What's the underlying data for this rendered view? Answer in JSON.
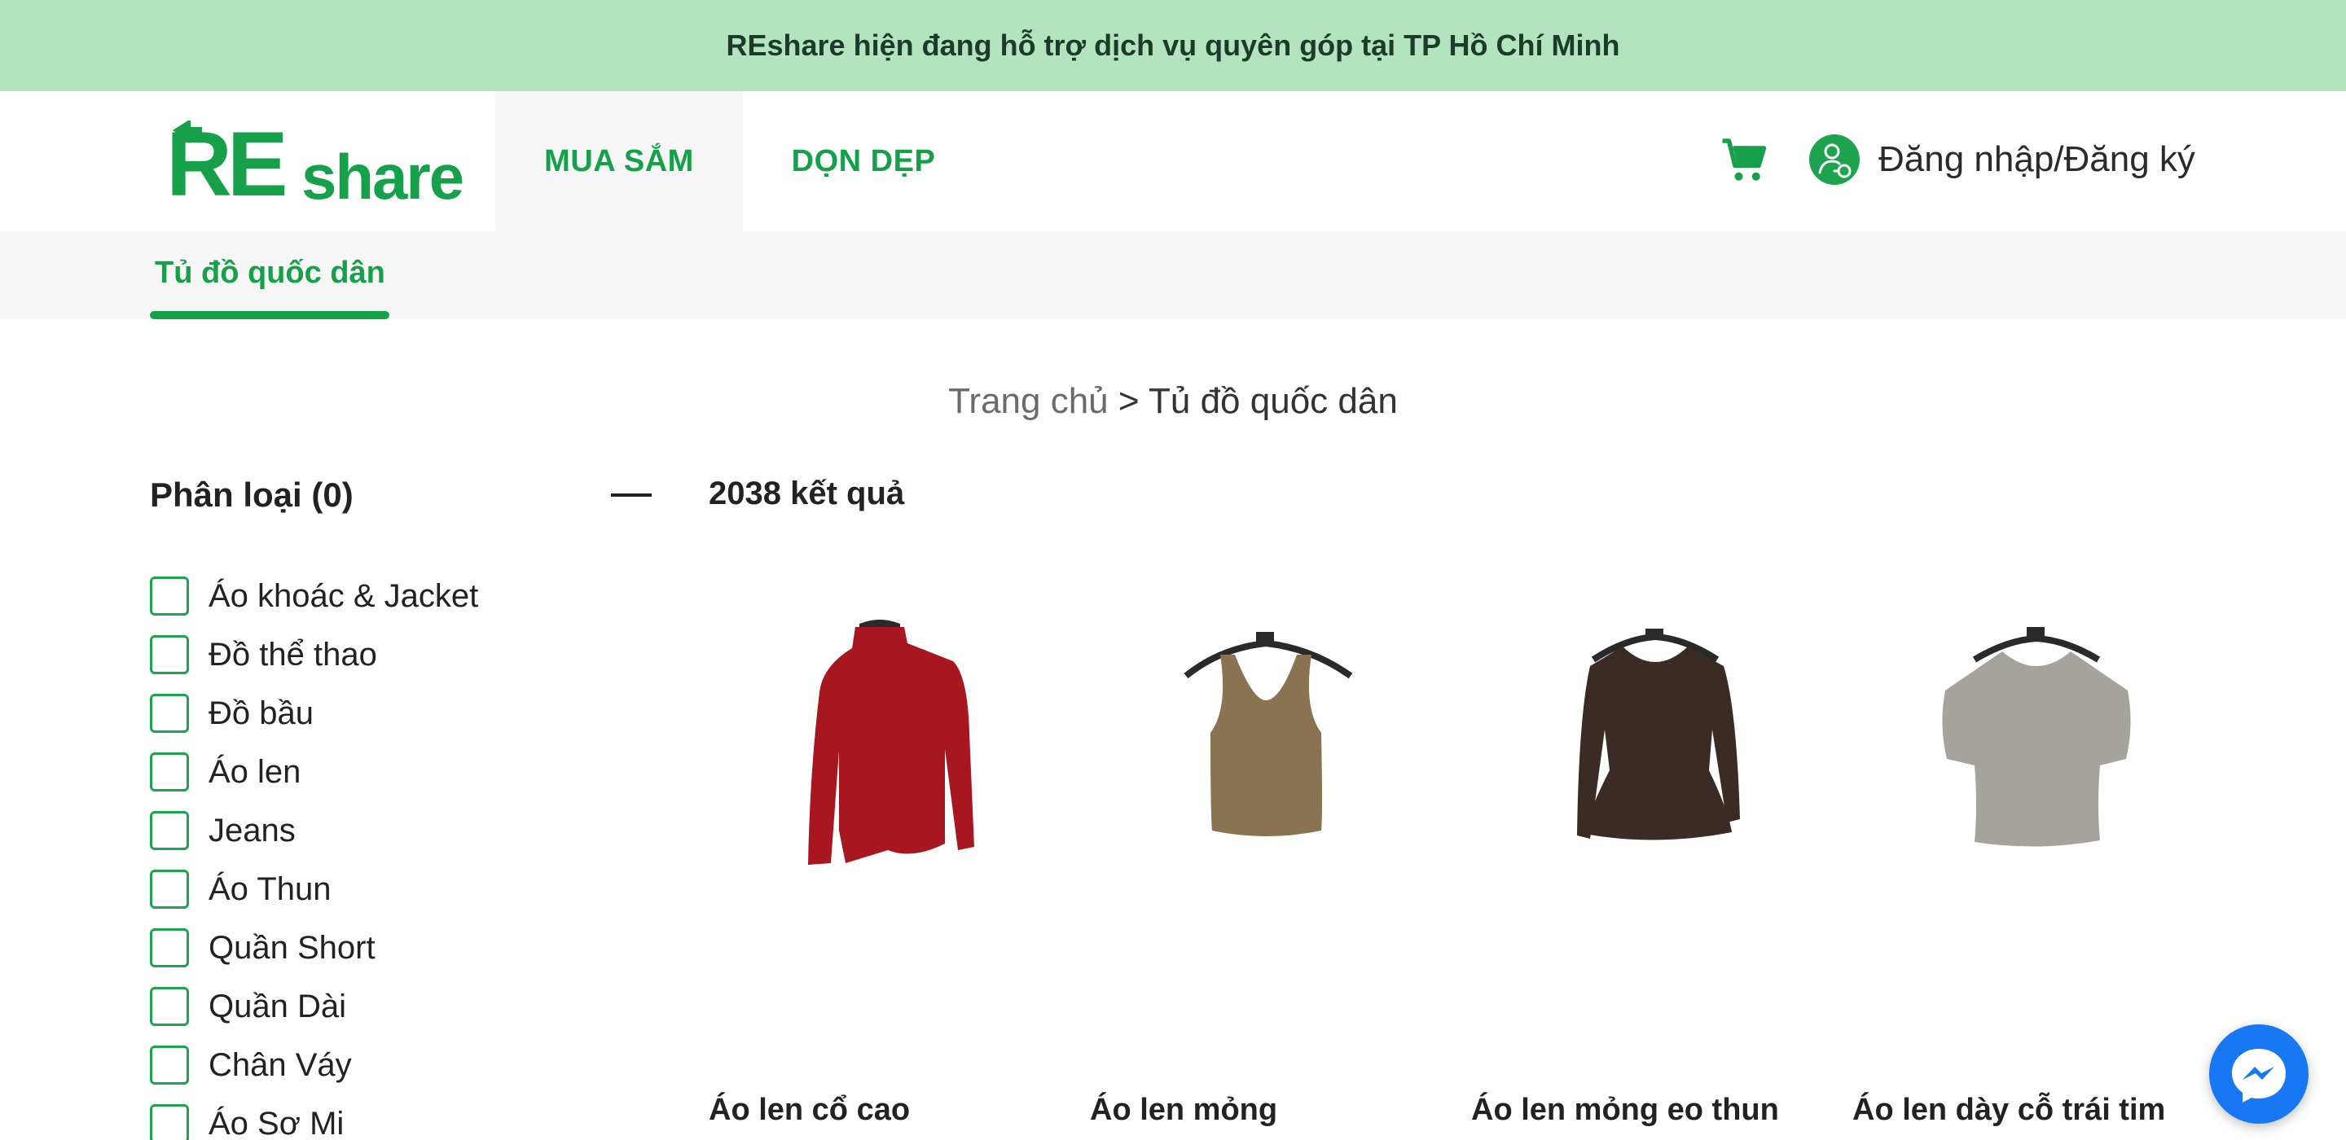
{
  "announcement": "REshare hiện đang hỗ trợ dịch vụ quyên góp tại TP Hồ Chí Minh",
  "logo": {
    "text_re": "RE",
    "text_share": "share"
  },
  "nav": {
    "shop": "MUA SẮM",
    "cleanup": "DỌN DẸP"
  },
  "header": {
    "login": "Đăng nhập/Đăng ký"
  },
  "subnav": {
    "tab": "Tủ đồ quốc dân"
  },
  "breadcrumb": {
    "home": "Trang chủ",
    "separator": " > ",
    "current": "Tủ đồ quốc dân"
  },
  "filter": {
    "title": "Phân loại (0)",
    "items": [
      {
        "label": "Áo khoác & Jacket"
      },
      {
        "label": "Đồ thể thao"
      },
      {
        "label": "Đồ bầu"
      },
      {
        "label": "Áo len"
      },
      {
        "label": "Jeans"
      },
      {
        "label": "Áo Thun"
      },
      {
        "label": "Quần Short"
      },
      {
        "label": "Quần Dài"
      },
      {
        "label": "Chân Váy"
      },
      {
        "label": "Áo Sơ Mi"
      }
    ]
  },
  "results": {
    "count": "2038 kết quả"
  },
  "products": [
    {
      "name": "Áo len cổ cao",
      "color": "#a8161f"
    },
    {
      "name": "Áo len mỏng",
      "color": "#8a7350"
    },
    {
      "name": "Áo len mỏng eo thun",
      "color": "#3a2c24"
    },
    {
      "name": "Áo len dày cỗ trái tim",
      "color": "#a6a39d"
    }
  ],
  "colors": {
    "brand_green": "#17a04a",
    "banner_bg": "#b2e5bd",
    "messenger_blue": "#1877f2"
  },
  "icons": {
    "cart": "cart-icon",
    "user": "user-icon",
    "messenger": "messenger-icon"
  }
}
